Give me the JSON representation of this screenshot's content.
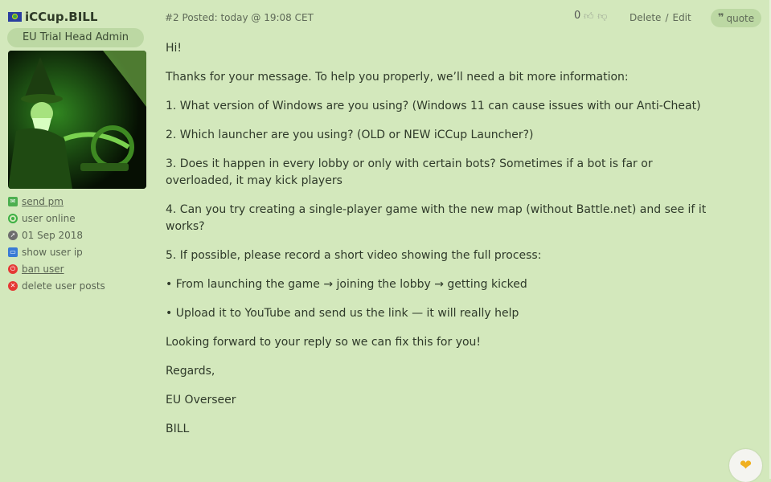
{
  "author": {
    "username": "iCCup.BILL",
    "rank": "EU Trial Head Admin",
    "actions": [
      {
        "label": "send pm",
        "icon": "mail-icon",
        "color": "#4caf50"
      },
      {
        "label": "user online",
        "icon": "online-icon",
        "color": "#3cb043"
      },
      {
        "label": "01 Sep 2018",
        "icon": "rocket-icon",
        "color": "#6e6e6e"
      },
      {
        "label": "show user ip",
        "icon": "monitor-icon",
        "color": "#3a7bd5"
      },
      {
        "label": "ban user",
        "icon": "power-icon",
        "color": "#e53935"
      },
      {
        "label": "delete user posts",
        "icon": "delete-icon",
        "color": "#e53935"
      }
    ]
  },
  "post": {
    "meta": "#2 Posted: today @ 19:08 CET",
    "rating": "0",
    "delete_label": "Delete",
    "separator": "/",
    "edit_label": "Edit",
    "quote_label": "quote",
    "paragraphs": [
      "Hi!",
      "Thanks for your message. To help you properly, we’ll need a bit more information:",
      "1. What version of Windows are you using? (Windows 11 can cause issues with our Anti-Cheat)",
      "2. Which launcher are you using? (OLD or NEW iCCup Launcher?)",
      "3. Does it happen in every lobby or only with certain bots? Sometimes if a bot is far or overloaded, it may kick players",
      "4. Can you try creating a single-player game with the new map (without Battle.net) and see if it works?",
      "5. If possible, please record a short video showing the full process:",
      "• From launching the game → joining the lobby → getting kicked",
      "• Upload it to YouTube and send us the link — it will really help",
      "Looking forward to your reply so we can fix this for you!",
      "Regards,",
      "EU Overseer",
      "BILL"
    ]
  },
  "colors": {
    "background": "#d3e8bc",
    "pill": "#bcd8a3",
    "text": "#2f3a2a",
    "heart": "#f0b020"
  }
}
